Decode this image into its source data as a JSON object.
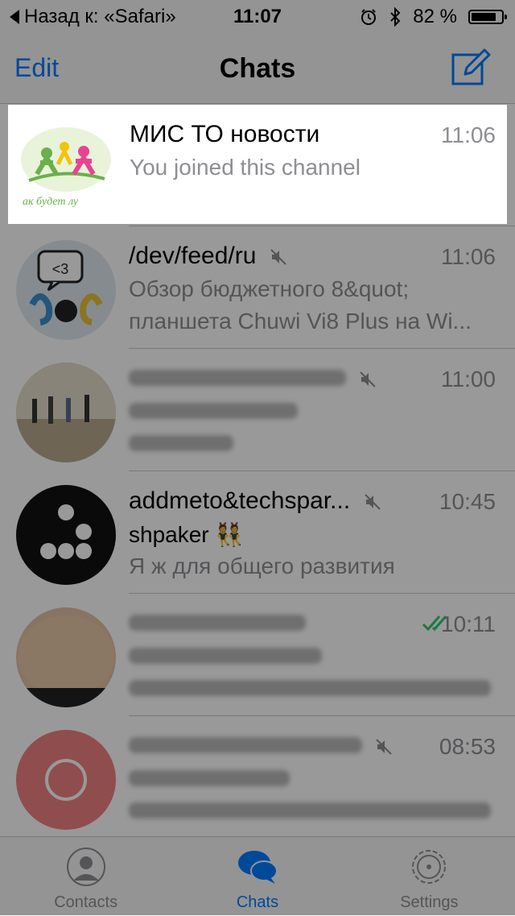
{
  "status_bar": {
    "back_label": "Назад к: «Safari»",
    "time": "11:07",
    "battery_percent_label": "82 %",
    "battery_level": 0.82
  },
  "nav": {
    "edit_label": "Edit",
    "title": "Chats"
  },
  "highlighted_chat": {
    "name": "МИС ТО новости",
    "time": "11:06",
    "message": "You joined this channel",
    "avatar_caption": "ак будет лу"
  },
  "chats": [
    {
      "name": "/dev/feed/ru",
      "time": "11:06",
      "line1": "Обзор бюджетного 8&quot;",
      "line2": "планшета Chuwi Vi8 Plus на Wi...",
      "muted": true
    },
    {
      "name": "",
      "time": "11:00",
      "line1": "",
      "line2": "",
      "muted": true,
      "blurred": true
    },
    {
      "name": "addmeto&techspar...",
      "time": "10:45",
      "line1": "shpaker 👯",
      "line2": "Я ж для общего развития",
      "muted": true
    },
    {
      "name": "",
      "time": "10:11",
      "line1": "",
      "line2": "",
      "muted": false,
      "read": true,
      "blurred": true
    },
    {
      "name": "",
      "time": "08:53",
      "line1": "",
      "line2": "",
      "muted": true,
      "blurred": true
    }
  ],
  "tabs": [
    {
      "label": "Contacts",
      "icon": "contacts-icon"
    },
    {
      "label": "Chats",
      "icon": "chats-icon",
      "active": true
    },
    {
      "label": "Settings",
      "icon": "settings-icon"
    }
  ],
  "colors": {
    "accent": "#007aff",
    "read_ticks": "#2ecc71",
    "overlay": "rgba(0,0,0,0.4)"
  }
}
